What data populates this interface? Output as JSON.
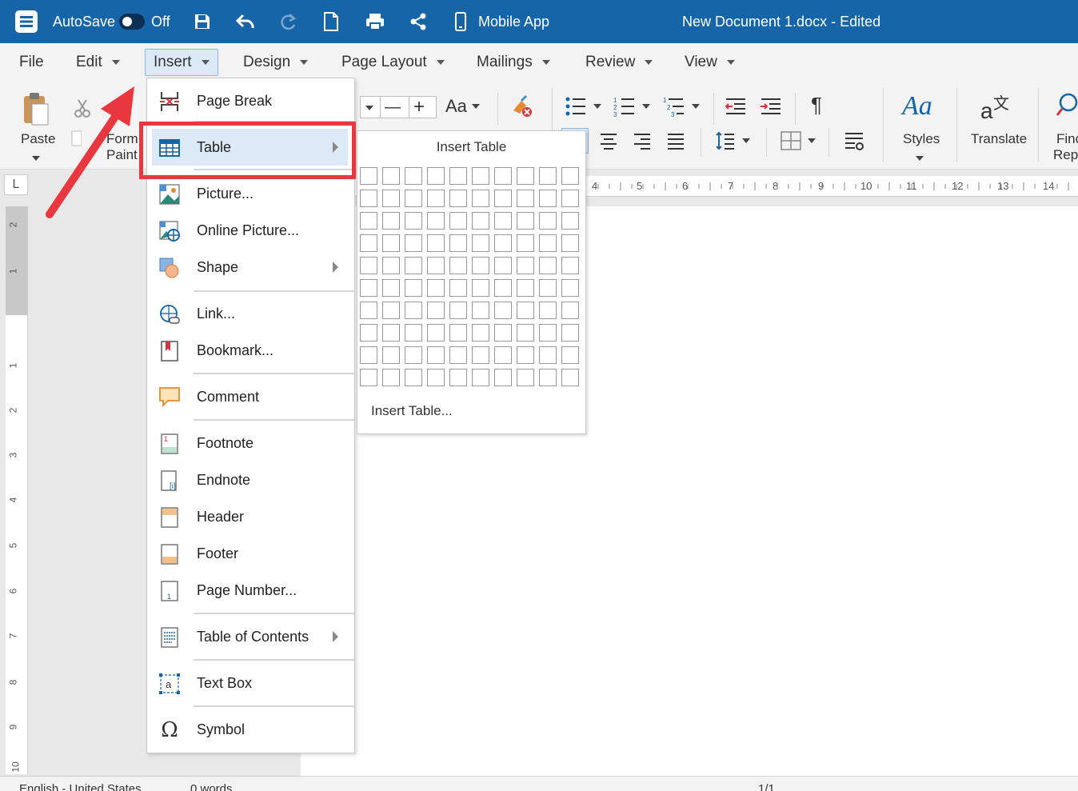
{
  "titlebar": {
    "autosave_label": "AutoSave",
    "autosave_state": "Off",
    "mobile_app_label": "Mobile App",
    "document_title": "New Document 1.docx - Edited",
    "bg_color": "#1565a8"
  },
  "menubar": {
    "items": [
      {
        "label": "File"
      },
      {
        "label": "Edit"
      },
      {
        "label": "Insert"
      },
      {
        "label": "Design"
      },
      {
        "label": "Page Layout"
      },
      {
        "label": "Mailings"
      },
      {
        "label": "Review"
      },
      {
        "label": "View"
      }
    ],
    "active": "Insert"
  },
  "ribbon": {
    "paste_label": "Paste",
    "format_painter_label_1": "Form",
    "format_painter_label_2": "Paint",
    "case_label": "Aa",
    "styles_label": "Styles",
    "styles_icon_text": "Aa",
    "translate_label": "Translate",
    "find_label_1": "Finc",
    "find_label_2": "Repl",
    "pilcrow": "¶"
  },
  "ruler": {
    "numbers": [
      "4",
      "5",
      "6",
      "7",
      "8",
      "9",
      "10",
      "11",
      "12",
      "13",
      "14"
    ],
    "vertical_numbers": [
      "2",
      "1",
      "1",
      "2",
      "3",
      "4",
      "5",
      "6",
      "7",
      "8",
      "9",
      "10"
    ],
    "corner_symbol": "L"
  },
  "insert_menu": {
    "items": [
      {
        "label": "Page Break",
        "icon": "page-break-icon"
      },
      {
        "label": "Table",
        "icon": "table-icon",
        "submenu": true
      },
      {
        "label": "Picture...",
        "icon": "picture-icon"
      },
      {
        "label": "Online Picture...",
        "icon": "online-picture-icon"
      },
      {
        "label": "Shape",
        "icon": "shape-icon",
        "submenu": true
      },
      {
        "label": "Link...",
        "icon": "link-icon"
      },
      {
        "label": "Bookmark...",
        "icon": "bookmark-icon"
      },
      {
        "label": "Comment",
        "icon": "comment-icon"
      },
      {
        "label": "Footnote",
        "icon": "footnote-icon"
      },
      {
        "label": "Endnote",
        "icon": "endnote-icon"
      },
      {
        "label": "Header",
        "icon": "header-icon"
      },
      {
        "label": "Footer",
        "icon": "footer-icon"
      },
      {
        "label": "Page Number...",
        "icon": "page-number-icon"
      },
      {
        "label": "Table of Contents",
        "icon": "table-of-contents-icon",
        "submenu": true
      },
      {
        "label": "Text Box",
        "icon": "text-box-icon"
      },
      {
        "label": "Symbol",
        "icon": "symbol-icon"
      }
    ]
  },
  "table_submenu": {
    "title": "Insert Table",
    "grid_columns": 10,
    "grid_rows": 10,
    "insert_table_label": "Insert Table..."
  },
  "statusbar": {
    "language": "English - United States",
    "words": "0 words",
    "page": "1/1"
  },
  "highlight_color": "#e8373f"
}
